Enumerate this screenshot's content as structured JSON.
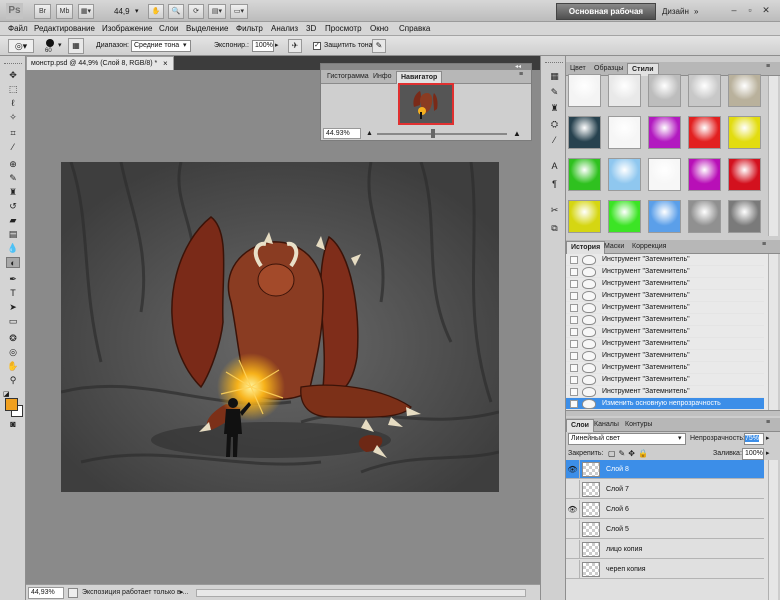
{
  "app": {
    "logo": "Ps",
    "zoom_display": "44,9",
    "workspace_button": "Основная рабочая среда",
    "design_label": "Дизайн",
    "title_buttons": [
      "Br",
      "Mb"
    ]
  },
  "menu": [
    "Файл",
    "Редактирование",
    "Изображение",
    "Слои",
    "Выделение",
    "Фильтр",
    "Анализ",
    "3D",
    "Просмотр",
    "Окно",
    "Справка"
  ],
  "options": {
    "brush_size": "60",
    "range_label": "Диапазон:",
    "range_value": "Средние тона",
    "exposure_label": "Экспонир.:",
    "exposure_value": "100%",
    "protect_tones_label": "Защитить тона",
    "protect_tones_checked": true
  },
  "document": {
    "tab_title": "монстр.psd @ 44,9% (Слой 8, RGB/8) *",
    "status_zoom": "44,93%",
    "status_text": "Экспозиция работает только в ..."
  },
  "navigator_panel": {
    "tabs": [
      "Гистограмма",
      "Инфо",
      "Навигатор"
    ],
    "active_tab": "Навигатор",
    "zoom": "44.93%"
  },
  "swatches_panel": {
    "tabs": [
      "Цвет",
      "Образцы",
      "Стили"
    ],
    "active_tab": "Стили",
    "styles": [
      {
        "name": "style-none",
        "color": "#f4f4f4"
      },
      {
        "name": "style-white-gloss",
        "color": "#e9e9e9"
      },
      {
        "name": "style-gray-bevel",
        "color": "#bdbdbd"
      },
      {
        "name": "style-silver",
        "color": "#c8c8c8"
      },
      {
        "name": "style-khaki",
        "color": "#b9b19c"
      },
      {
        "name": "style-teal-dark",
        "color": "#27424f"
      },
      {
        "name": "style-white",
        "color": "#f6f6f6"
      },
      {
        "name": "style-purple",
        "color": "#b21ac0"
      },
      {
        "name": "style-red",
        "color": "#e22020"
      },
      {
        "name": "style-yellow",
        "color": "#e2dc10"
      },
      {
        "name": "style-green",
        "color": "#2fc11f"
      },
      {
        "name": "style-light-blue",
        "color": "#8fc7ef"
      },
      {
        "name": "style-soft-white",
        "color": "#f7f7f7"
      },
      {
        "name": "style-magenta",
        "color": "#b80fb7"
      },
      {
        "name": "style-crimson",
        "color": "#d3111e"
      },
      {
        "name": "style-lime",
        "color": "#d5d612"
      },
      {
        "name": "style-bright-green",
        "color": "#3ce425"
      },
      {
        "name": "style-blue",
        "color": "#5b9fe9"
      },
      {
        "name": "style-chrome",
        "color": "#909090"
      },
      {
        "name": "style-steel",
        "color": "#7a7a7a"
      }
    ]
  },
  "history_panel": {
    "tabs": [
      "История",
      "Маски",
      "Коррекция"
    ],
    "active_tab": "История",
    "items": [
      "Инструмент \"Затемнитель\"",
      "Инструмент \"Затемнитель\"",
      "Инструмент \"Затемнитель\"",
      "Инструмент \"Затемнитель\"",
      "Инструмент \"Затемнитель\"",
      "Инструмент \"Затемнитель\"",
      "Инструмент \"Затемнитель\"",
      "Инструмент \"Затемнитель\"",
      "Инструмент \"Затемнитель\"",
      "Инструмент \"Затемнитель\"",
      "Инструмент \"Затемнитель\"",
      "Инструмент \"Затемнитель\"",
      "Изменить основную непрозрачность"
    ],
    "selected_item": "Изменить основную непрозрачность"
  },
  "layers_panel": {
    "tabs": [
      "Слои",
      "Каналы",
      "Контуры"
    ],
    "active_tab": "Слои",
    "blend_mode": "Линейный свет",
    "opacity_label": "Непрозрачность:",
    "opacity_value": "75%",
    "lock_label": "Закрепить:",
    "fill_label": "Заливка:",
    "fill_value": "100%",
    "layers": [
      {
        "name": "Слой 8",
        "visible": true,
        "selected": true
      },
      {
        "name": "Слой 7",
        "visible": false,
        "selected": false
      },
      {
        "name": "Слой 6",
        "visible": true,
        "selected": false
      },
      {
        "name": "Слой 5",
        "visible": false,
        "selected": false
      },
      {
        "name": "лицо копия",
        "visible": false,
        "selected": false
      },
      {
        "name": "череп копия",
        "visible": false,
        "selected": false
      }
    ]
  },
  "colors": {
    "foreground": "#f0a020",
    "background": "#ffffff",
    "selection_blue": "#3c8ee8"
  }
}
